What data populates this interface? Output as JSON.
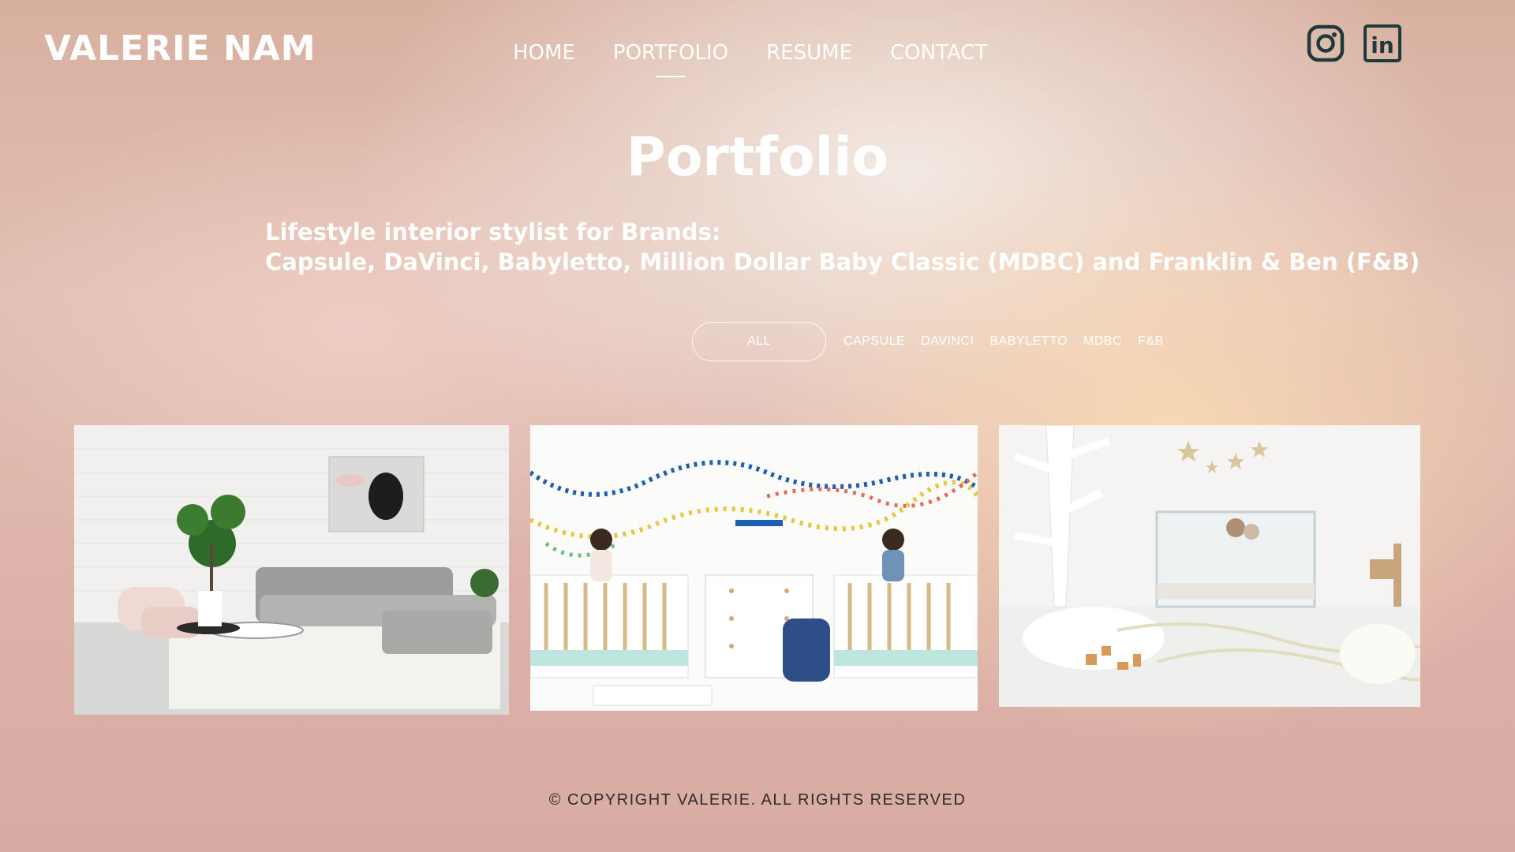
{
  "header": {
    "brand": "VALERIE NAM",
    "nav": [
      {
        "label": "HOME"
      },
      {
        "label": "PORTFOLIO",
        "active": true
      },
      {
        "label": "RESUME"
      },
      {
        "label": "CONTACT"
      }
    ],
    "social": [
      {
        "icon": "instagram-icon"
      },
      {
        "icon": "linkedin-icon",
        "text": "in"
      }
    ]
  },
  "main": {
    "title": "Portfolio",
    "subtitle_line1": "Lifestyle interior stylist for Brands:",
    "subtitle_line2": "Capsule, DaVinci, Babyletto, Million Dollar Baby Classic (MDBC) and Franklin & Ben (F&B)",
    "filters": [
      "ALL",
      "CAPSULE",
      "DAVINCI",
      "BABYLETTO",
      "MDBC",
      "F&B"
    ],
    "active_filter": "ALL",
    "gallery": [
      {
        "subject": "living-room-sofa-photo"
      },
      {
        "subject": "twin-nursery-cribs-photo"
      },
      {
        "subject": "white-nursery-acrylic-crib-photo"
      }
    ]
  },
  "footer": {
    "copyright": "© COPYRIGHT VALERIE. ALL RIGHTS RESERVED"
  },
  "colors": {
    "text": "#ffffff",
    "footer_text": "#2f2a28",
    "icon_dark": "#1f3a3a",
    "bg_peach": "#e2bfb2"
  }
}
